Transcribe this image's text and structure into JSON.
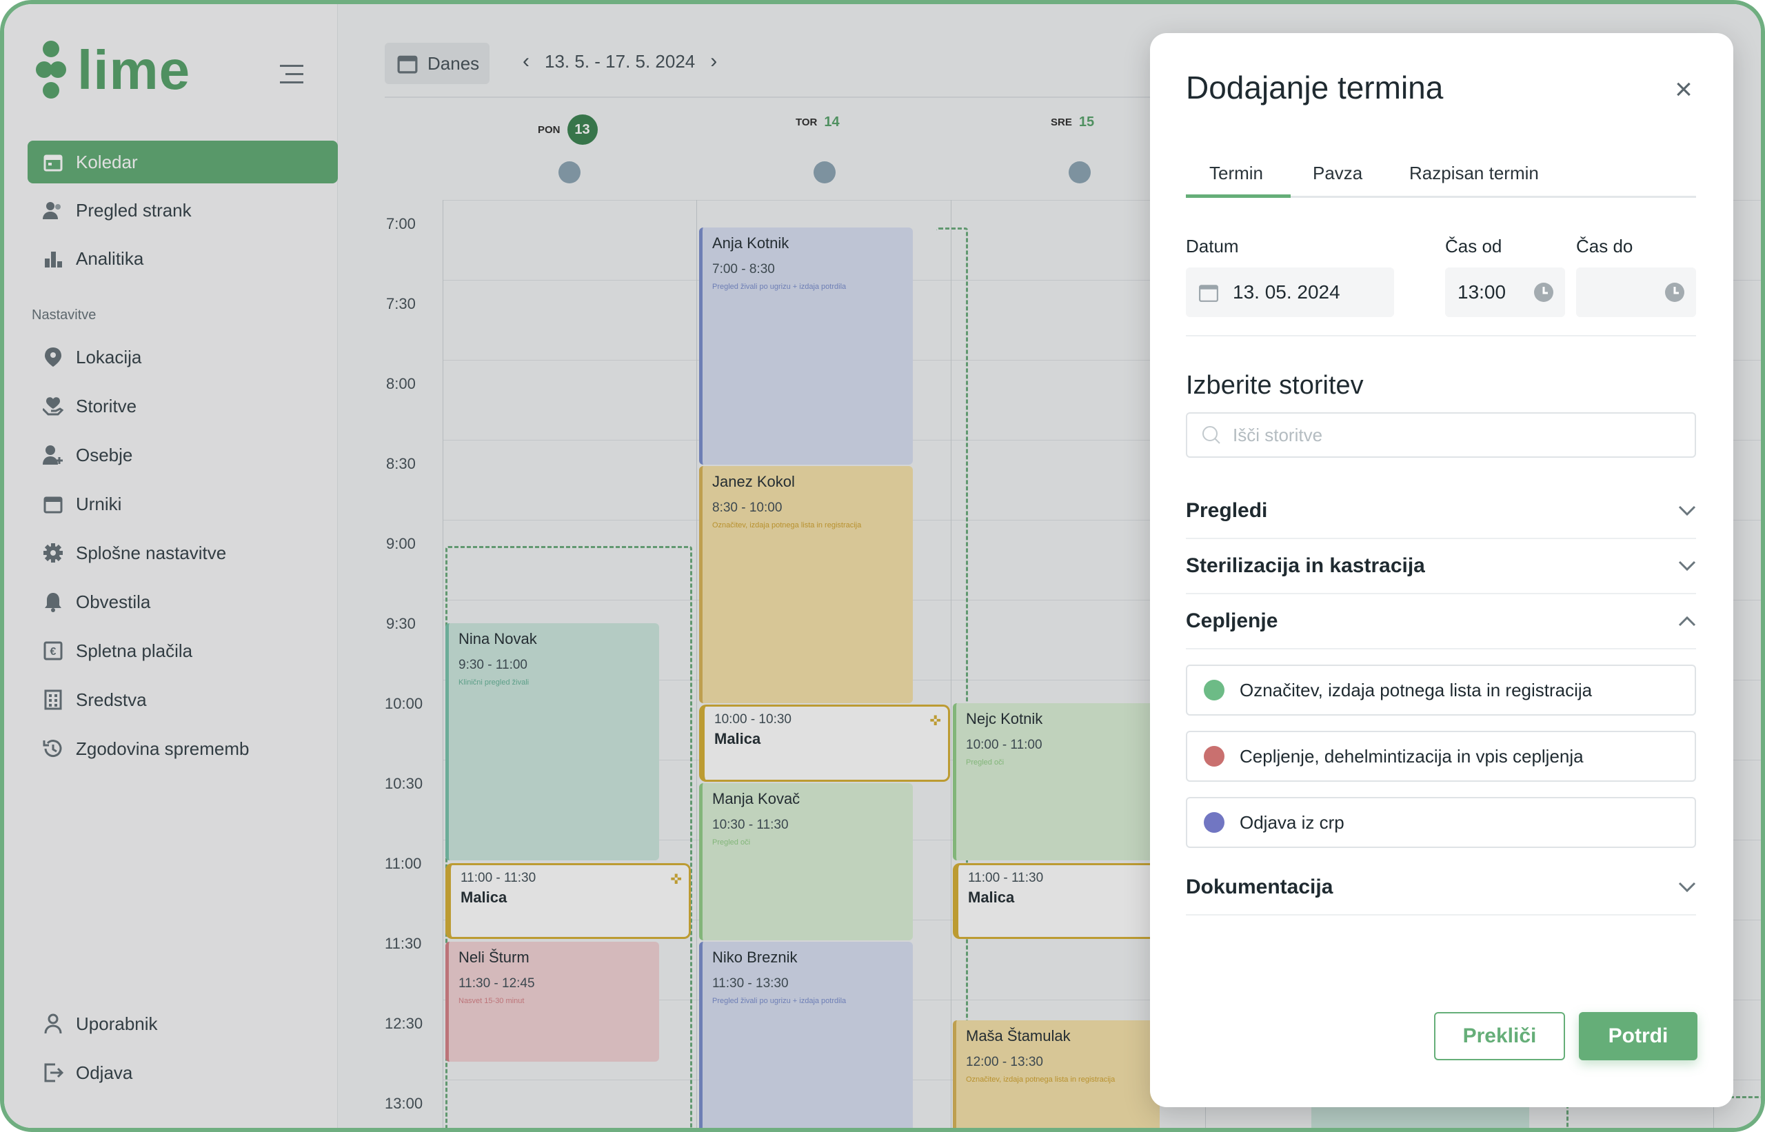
{
  "app": {
    "logo_text": "lime"
  },
  "sidebar": {
    "items": [
      {
        "label": "Koledar",
        "icon": "calendar-icon"
      },
      {
        "label": "Pregled strank",
        "icon": "users-icon"
      },
      {
        "label": "Analitika",
        "icon": "bar-chart-icon"
      }
    ],
    "section_label": "Nastavitve",
    "settings": [
      {
        "label": "Lokacija",
        "icon": "location-pin-icon"
      },
      {
        "label": "Storitve",
        "icon": "hand-heart-icon"
      },
      {
        "label": "Osebje",
        "icon": "user-add-icon"
      },
      {
        "label": "Urniki",
        "icon": "calendar-icon"
      },
      {
        "label": "Splošne nastavitve",
        "icon": "gear-icon"
      },
      {
        "label": "Obvestila",
        "icon": "bell-icon"
      },
      {
        "label": "Spletna plačila",
        "icon": "euro-icon"
      },
      {
        "label": "Sredstva",
        "icon": "building-icon"
      },
      {
        "label": "Zgodovina sprememb",
        "icon": "history-icon"
      }
    ],
    "bottom": [
      {
        "label": "Uporabnik",
        "icon": "user-icon"
      },
      {
        "label": "Odjava",
        "icon": "logout-icon"
      }
    ]
  },
  "calendar": {
    "today_label": "Danes",
    "range": "13. 5. - 17. 5. 2024",
    "days": [
      {
        "name": "PON",
        "num": "13"
      },
      {
        "name": "TOR",
        "num": "14"
      },
      {
        "name": "SRE",
        "num": "15"
      }
    ],
    "times": [
      "7:00",
      "7:30",
      "8:00",
      "8:30",
      "9:00",
      "9:30",
      "10:00",
      "10:30",
      "11:00",
      "11:30",
      "12:30",
      "13:00"
    ],
    "events": [
      {
        "name": "Anja Kotnik",
        "time": "7:00 - 8:30",
        "desc": "Pregled živali po ugrizu + izdaja potrdila"
      },
      {
        "name": "Janez Kokol",
        "time": "8:30 - 10:00",
        "desc": "Označitev, izdaja potnega lista in registracija"
      },
      {
        "name": "Nina Novak",
        "time": "9:30 - 11:00",
        "desc": "Klinični pregled živali"
      },
      {
        "name": "Manja Kovač",
        "time": "10:30 - 11:30",
        "desc": "Pregled oči"
      },
      {
        "name": "Nejc Kotnik",
        "time": "10:00 - 11:00",
        "desc": "Pregled oči"
      },
      {
        "name": "Neli Šturm",
        "time": "11:30 - 12:45",
        "desc": "Nasvet 15-30 minut"
      },
      {
        "name": "Niko Breznik",
        "time": "11:30 - 13:30",
        "desc": "Pregled živali po ugrizu + izdaja potrdila"
      },
      {
        "name": "Maša Štamulak",
        "time": "12:00 - 13:30",
        "desc": "Označitev, izdaja potnega lista in registracija"
      }
    ],
    "breaks": [
      {
        "time": "10:00 - 10:30",
        "name": "Malica"
      },
      {
        "time": "11:00 - 11:30",
        "name": "Malica"
      },
      {
        "time": "11:00 - 11:30",
        "name": "Malica"
      }
    ]
  },
  "modal": {
    "title": "Dodajanje termina",
    "tabs": [
      "Termin",
      "Pavza",
      "Razpisan termin"
    ],
    "date_label": "Datum",
    "date_value": "13. 05. 2024",
    "from_label": "Čas od",
    "from_value": "13:00",
    "to_label": "Čas do",
    "to_value": "",
    "services_title": "Izberite storitev",
    "search_placeholder": "Išči storitve",
    "categories": [
      "Pregledi",
      "Sterilizacija in kastracija",
      "Cepljenje",
      "Dokumentacija"
    ],
    "services": [
      {
        "label": "Označitev, izdaja potnega lista in registracija",
        "color": "#6dbb86"
      },
      {
        "label": "Cepljenje, dehelmintizacija in vpis cepljenja",
        "color": "#c9706f"
      },
      {
        "label": "Odjava iz crp",
        "color": "#7176c2"
      }
    ],
    "cancel_label": "Prekliči",
    "confirm_label": "Potrdi"
  }
}
